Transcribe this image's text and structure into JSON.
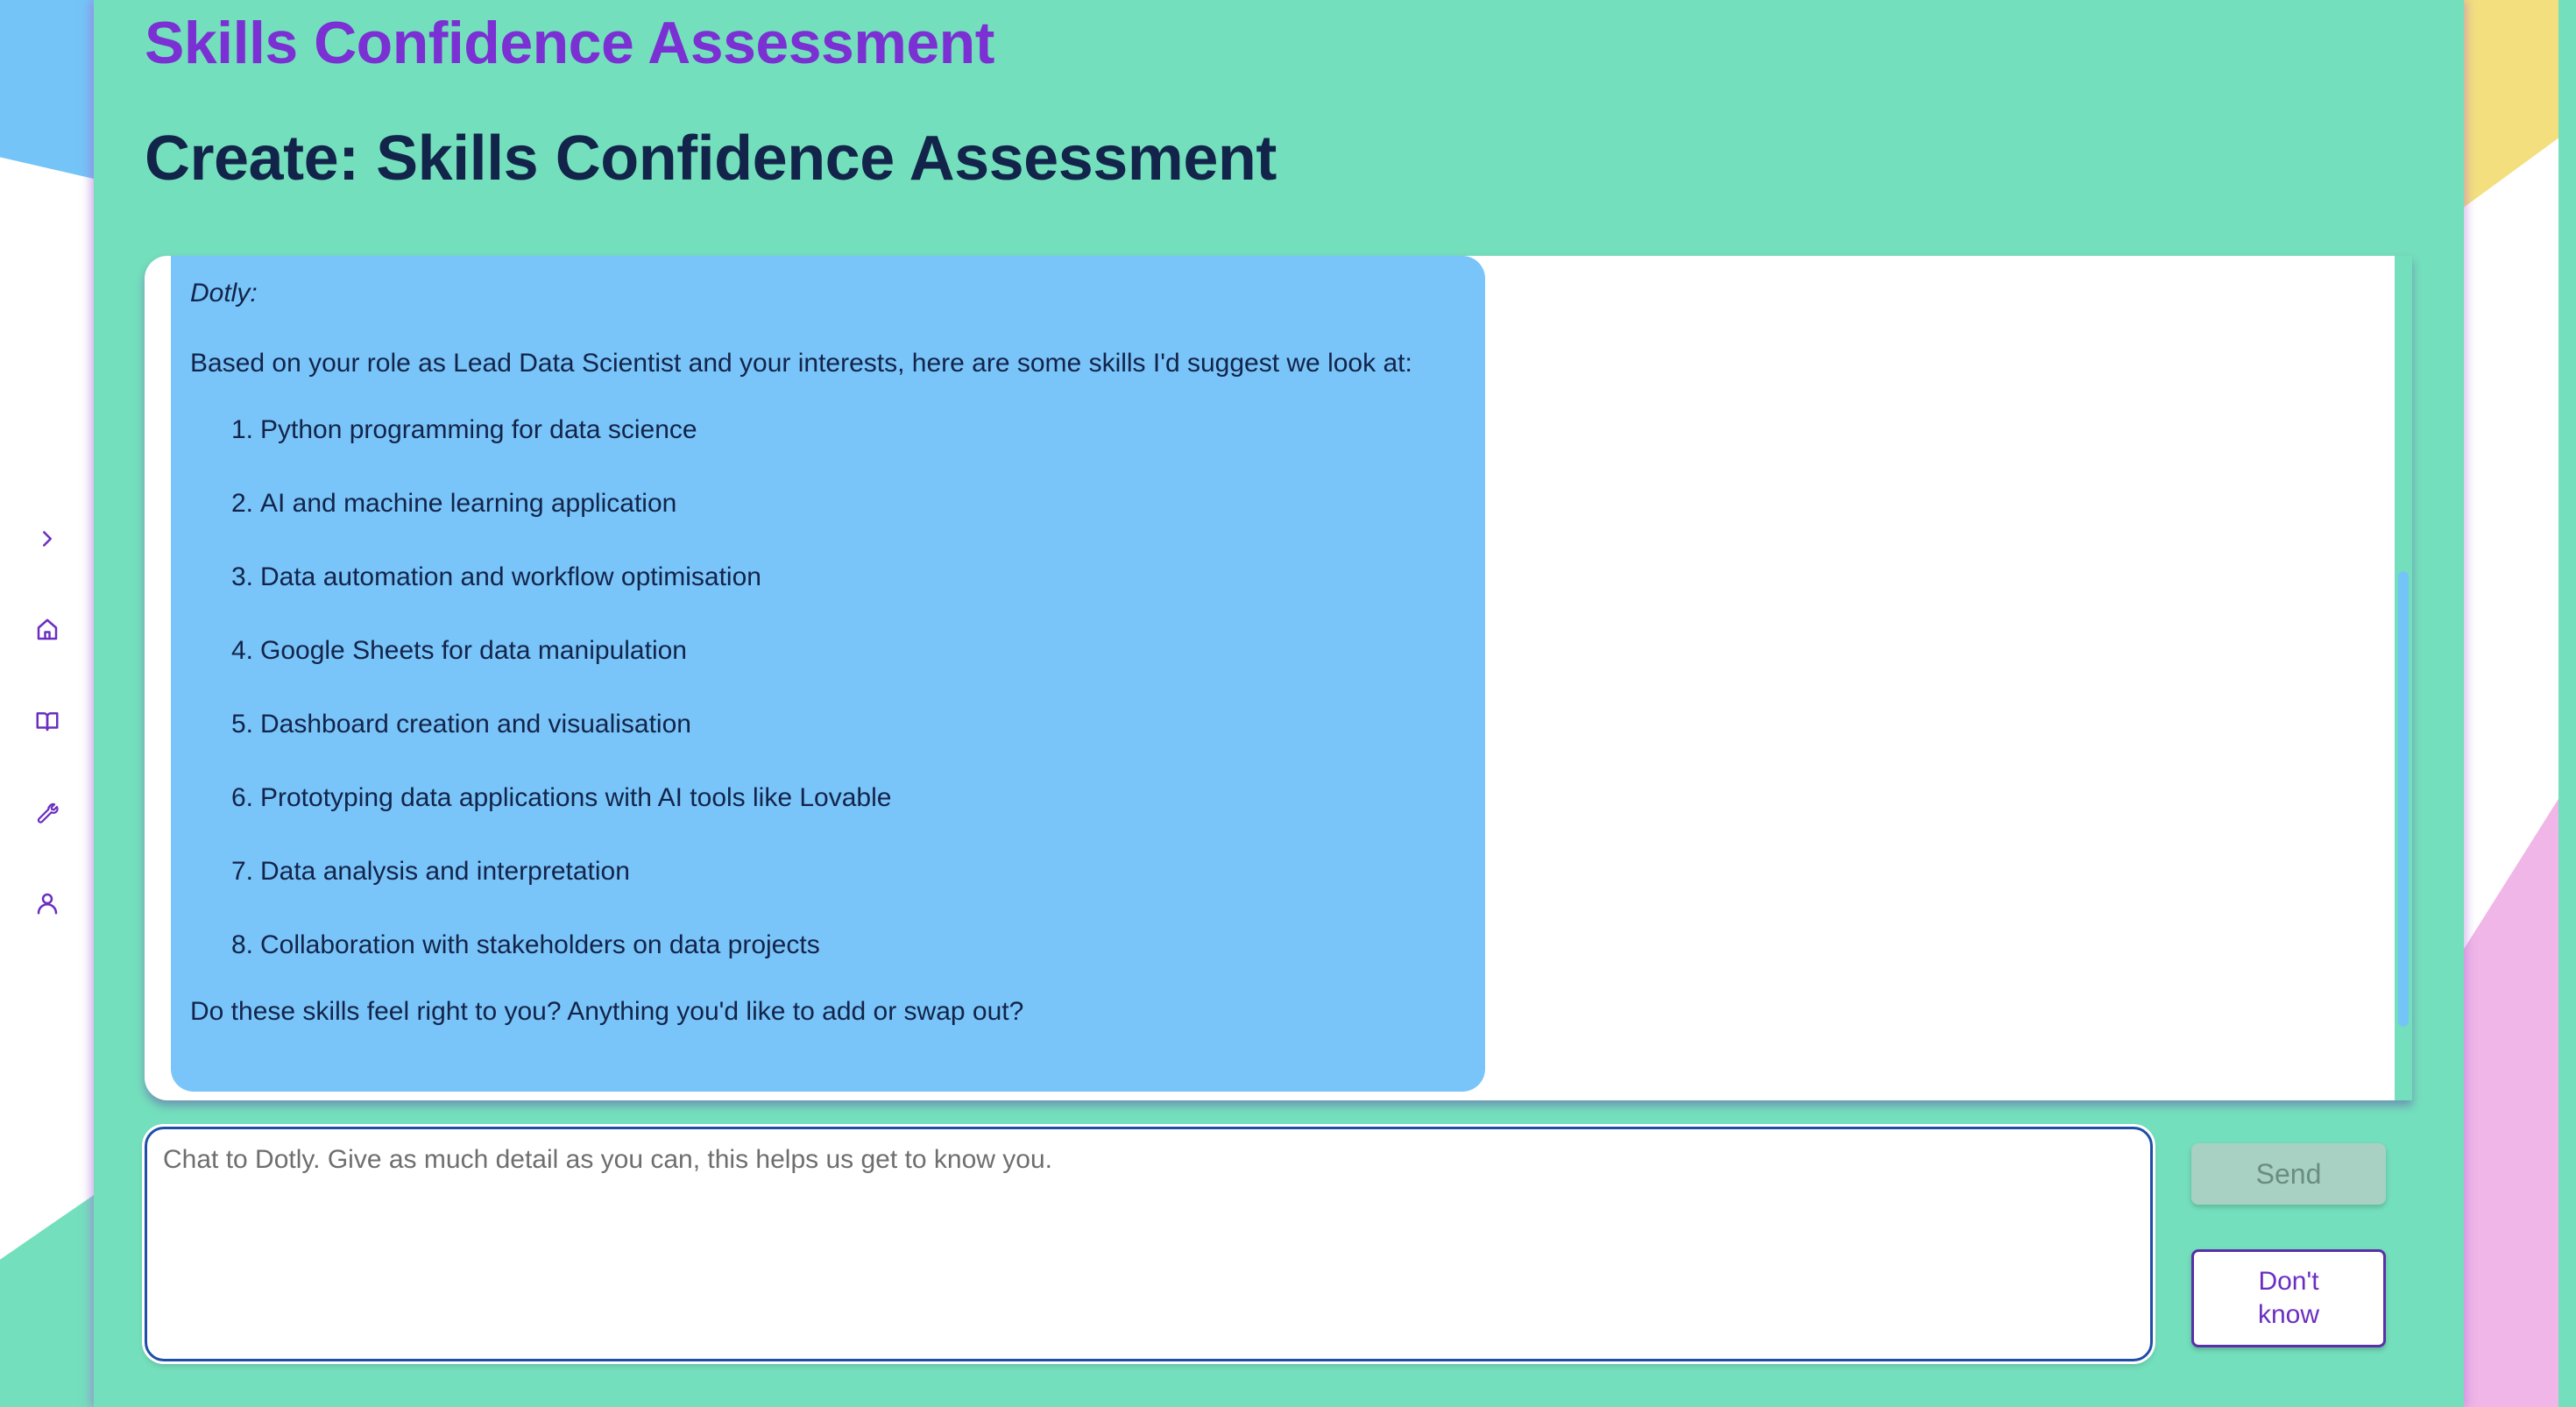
{
  "app": {
    "title": "Skills Confidence Assessment"
  },
  "page": {
    "title": "Create: Skills Confidence Assessment"
  },
  "sidebar": {
    "items": [
      {
        "name": "expand",
        "icon": "chevron-right-icon"
      },
      {
        "name": "home",
        "icon": "home-icon"
      },
      {
        "name": "library",
        "icon": "book-icon"
      },
      {
        "name": "tools",
        "icon": "wrench-icon"
      },
      {
        "name": "profile",
        "icon": "user-icon"
      }
    ]
  },
  "chat": {
    "messages": [
      {
        "speaker": "Dotly:",
        "intro": "Based on your role as Lead Data Scientist and your interests, here are some skills I'd suggest we look at:",
        "skills": [
          {
            "num": "1.",
            "text": "Python programming for data science"
          },
          {
            "num": "2.",
            "text": "AI and machine learning application"
          },
          {
            "num": "3.",
            "text": "Data automation and workflow optimisation"
          },
          {
            "num": "4.",
            "text": "Google Sheets for data manipulation"
          },
          {
            "num": "5.",
            "text": "Dashboard creation and visualisation"
          },
          {
            "num": "6.",
            "text": "Prototyping data applications with AI tools like Lovable"
          },
          {
            "num": "7.",
            "text": "Data analysis and interpretation"
          },
          {
            "num": "8.",
            "text": "Collaboration with stakeholders on data projects"
          }
        ],
        "closing": "Do these skills feel right to you? Anything you'd like to add or swap out?"
      }
    ],
    "input": {
      "value": "",
      "placeholder": "Chat to Dotly. Give as much detail as you can, this helps us get to know you."
    },
    "send_label": "Send",
    "dont_know_label": "Don't know"
  },
  "colors": {
    "panel": "#74dfbc",
    "bubble": "#79c4f8",
    "accent": "#7b30d3",
    "heading": "#13244a"
  }
}
